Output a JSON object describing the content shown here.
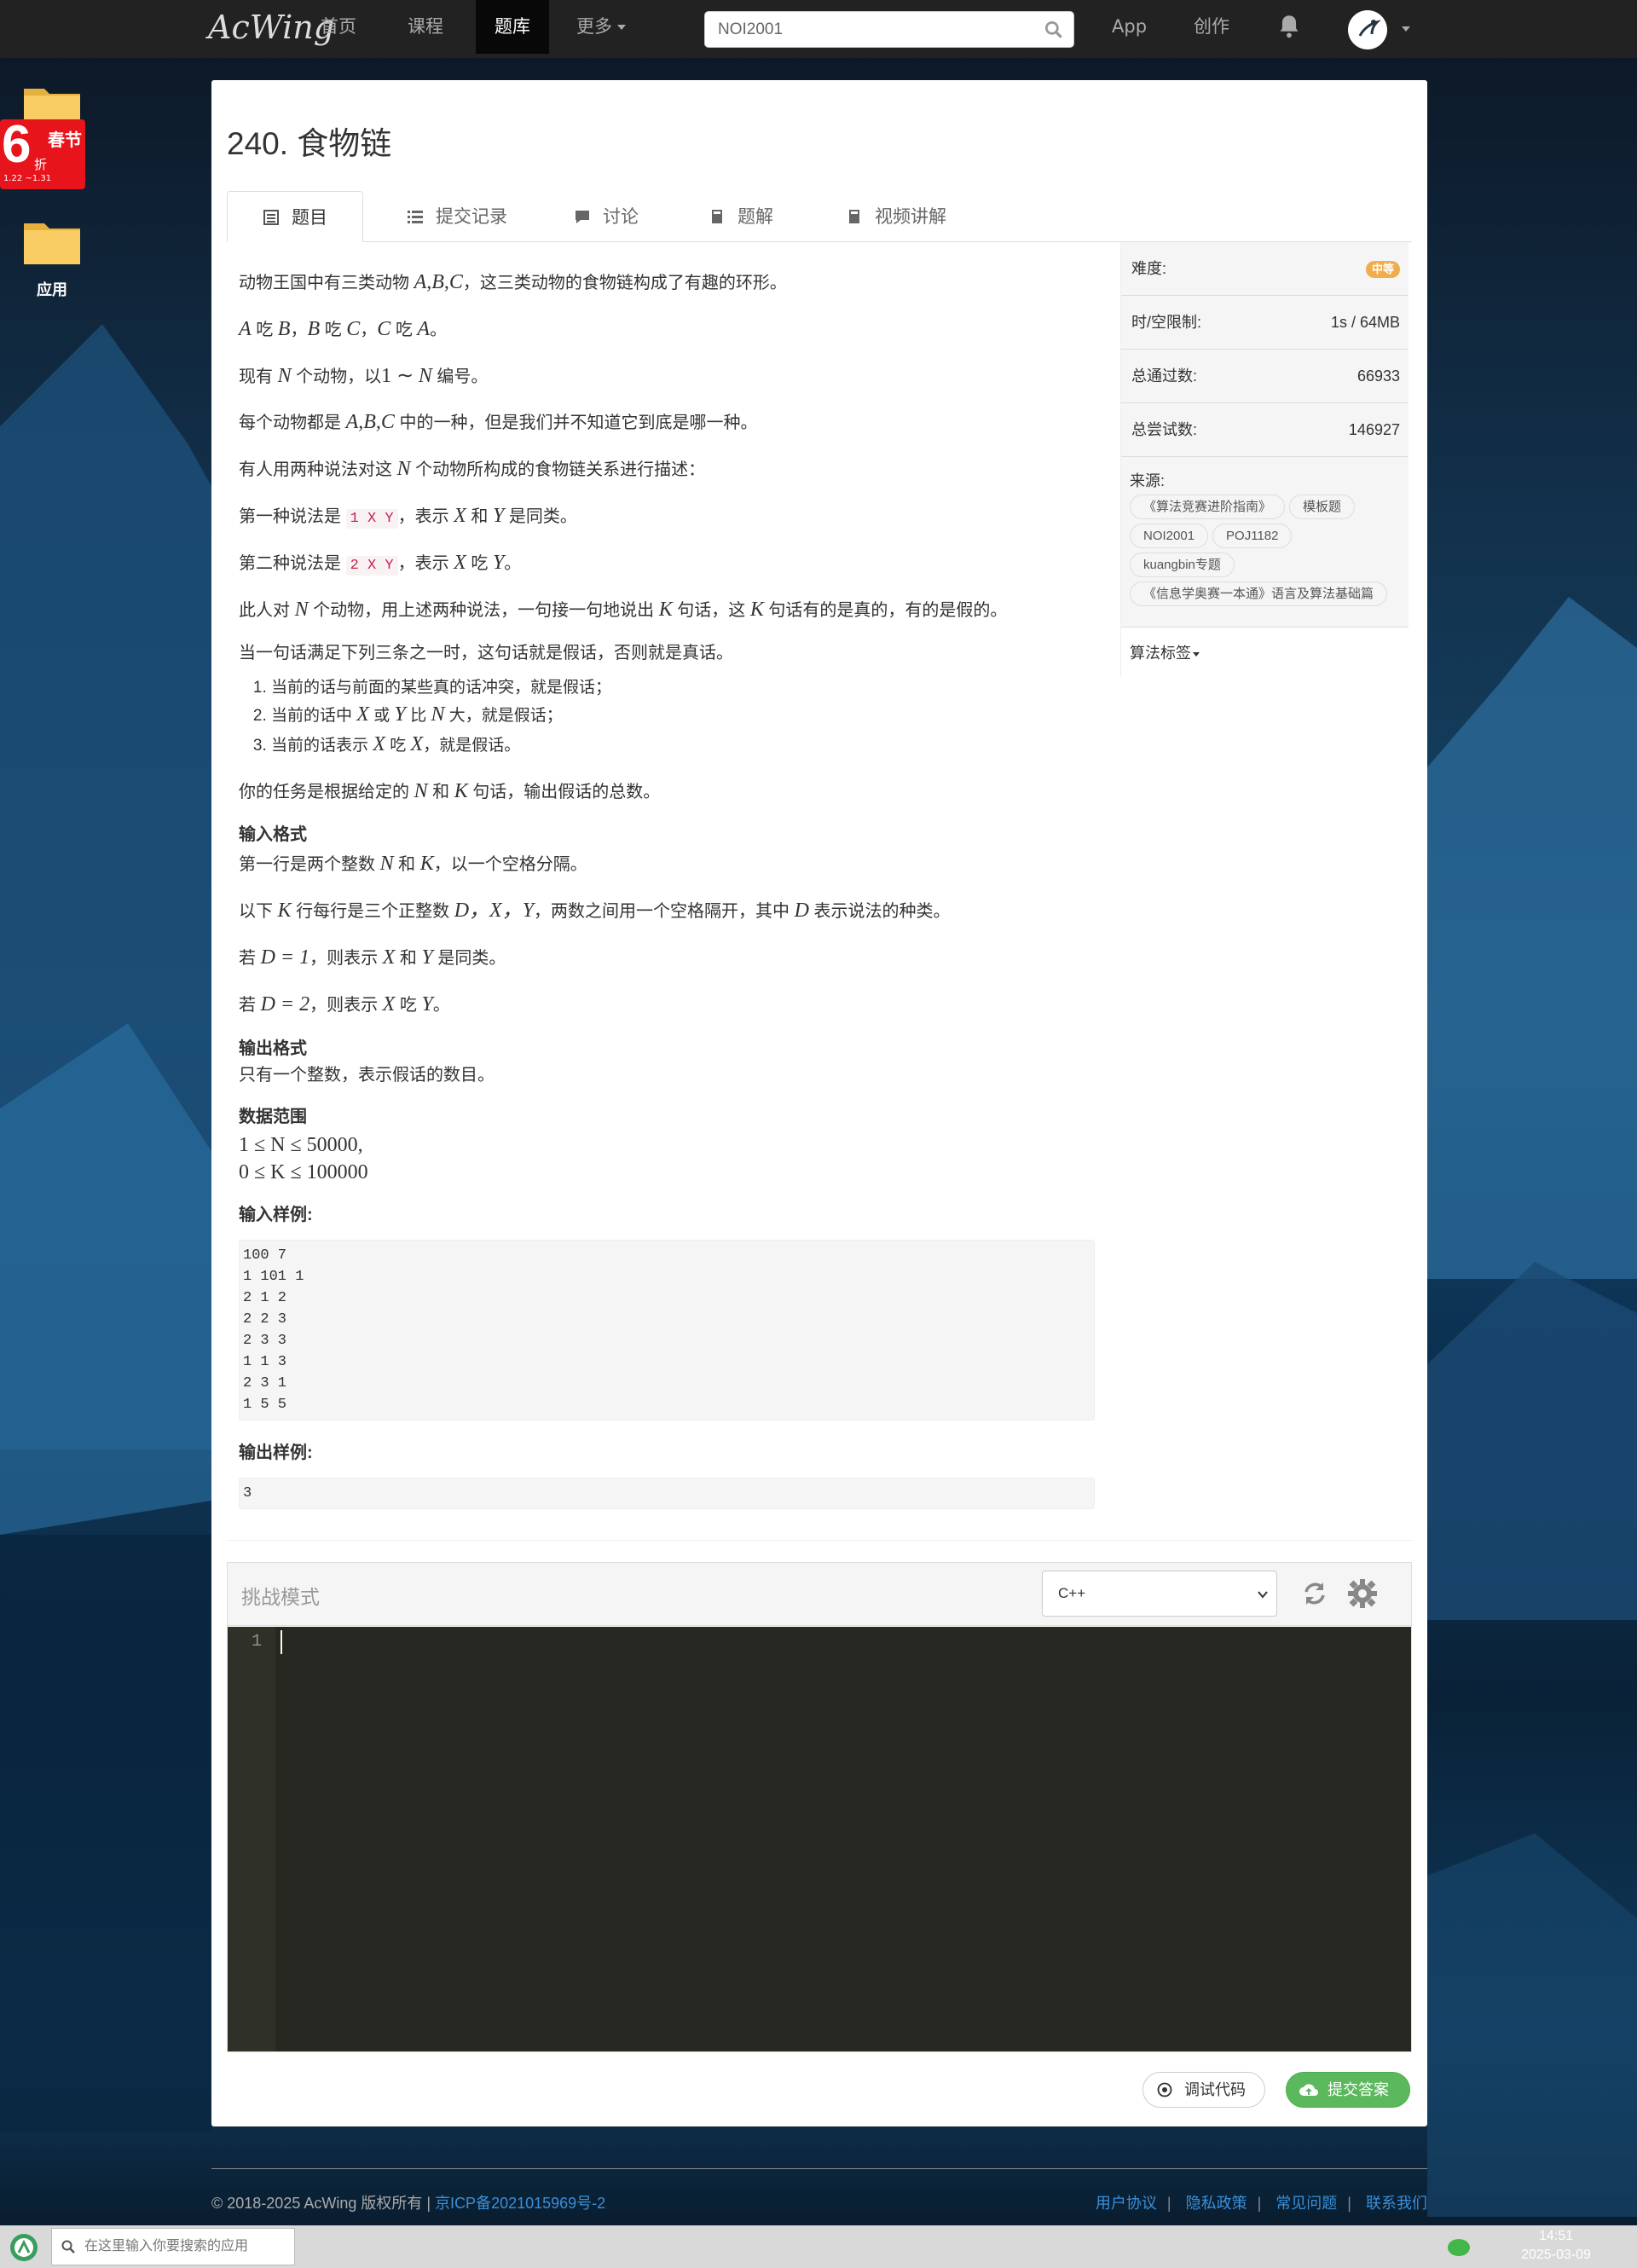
{
  "navbar": {
    "logo": "AcWing",
    "items": [
      {
        "label": "首页"
      },
      {
        "label": "课程"
      },
      {
        "label": "题库"
      },
      {
        "label": "更多"
      },
      {
        "label": "App"
      },
      {
        "label": "创作"
      }
    ],
    "search_value": "NOI2001"
  },
  "desktop": {
    "promo_big": "6",
    "promo_title": "春节",
    "promo_unit": "折",
    "promo_dates": "1.22 ~1.31",
    "app_label": "应用"
  },
  "problem": {
    "title": "240. 食物链",
    "tabs": [
      {
        "label": "题目"
      },
      {
        "label": "提交记录"
      },
      {
        "label": "讨论"
      },
      {
        "label": "题解"
      },
      {
        "label": "视频讲解"
      }
    ]
  },
  "statement": {
    "p1_a": "动物王国中有三类动物",
    "p1_math": "A,B,C",
    "p1_b": "，这三类动物的食物链构成了有趣的环形。",
    "p2": [
      "A",
      "吃",
      "B",
      "，",
      "B",
      "吃",
      "C",
      "，",
      "C",
      "吃",
      "A",
      "。"
    ],
    "p3_a": "现有",
    "p3_m1": "N",
    "p3_b": "个动物，以",
    "p3_m2": "1 ∼",
    "p3_m3": "N",
    "p3_c": "编号。",
    "p4_a": "每个动物都是",
    "p4_m": "A,B,C",
    "p4_b": "中的一种，但是我们并不知道它到底是哪一种。",
    "p5_a": "有人用两种说法对这",
    "p5_m": "N",
    "p5_b": "个动物所构成的食物链关系进行描述：",
    "p6_a": "第一种说法是",
    "p6_code": "1 X Y",
    "p6_b": "，表示",
    "p6_m1": "X",
    "p6_c": "和",
    "p6_m2": "Y",
    "p6_d": "是同类。",
    "p7_a": "第二种说法是",
    "p7_code": "2 X Y",
    "p7_b": "，表示",
    "p7_m1": "X",
    "p7_c": "吃",
    "p7_m2": "Y",
    "p7_d": "。",
    "p8_a": "此人对",
    "p8_m1": "N",
    "p8_b": "个动物，用上述两种说法，一句接一句地说出",
    "p8_m2": "K",
    "p8_c": "句话，这",
    "p8_m3": "K",
    "p8_d": "句话有的是真的，有的是假的。",
    "p9": "当一句话满足下列三条之一时，这句话就是假话，否则就是真话。",
    "li1": "当前的话与前面的某些真的话冲突，就是假话；",
    "li2_a": "当前的话中",
    "li2_m1": "X",
    "li2_b": "或",
    "li2_m2": "Y",
    "li2_c": "比",
    "li2_m3": "N",
    "li2_d": "大，就是假话；",
    "li3_a": "当前的话表示",
    "li3_m1": "X",
    "li3_b": "吃",
    "li3_m2": "X",
    "li3_c": "，就是假话。",
    "p10_a": "你的任务是根据给定的",
    "p10_m1": "N",
    "p10_b": "和",
    "p10_m2": "K",
    "p10_c": "句话，输出假话的总数。",
    "h_input": "输入格式",
    "in1_a": "第一行是两个整数",
    "in1_m1": "N",
    "in1_b": "和",
    "in1_m2": "K",
    "in1_c": "，以一个空格分隔。",
    "in2_a": "以下",
    "in2_m1": "K",
    "in2_b": "行每行是三个正整数",
    "in2_m2": "D，X，Y",
    "in2_c": "，两数之间用一个空格隔开，其中",
    "in2_m3": "D",
    "in2_d": "表示说法的种类。",
    "in3_a": "若",
    "in3_m": "D = 1",
    "in3_b": "，则表示",
    "in3_m1": "X",
    "in3_c": "和",
    "in3_m2": "Y",
    "in3_d": "是同类。",
    "in4_a": "若",
    "in4_m": "D = 2",
    "in4_b": "，则表示",
    "in4_m1": "X",
    "in4_c": "吃",
    "in4_m2": "Y",
    "in4_d": "。",
    "h_output": "输出格式",
    "out1": "只有一个整数，表示假话的数目。",
    "h_range": "数据范围",
    "range1": "1 ≤ N ≤ 50000,",
    "range2": "0 ≤ K ≤ 100000",
    "h_sample_in": "输入样例:",
    "sample_in": "100 7\n1 101 1\n2 1 2\n2 2 3\n2 3 3\n1 1 3\n2 3 1\n1 5 5",
    "h_sample_out": "输出样例:",
    "sample_out": "3"
  },
  "sidebar": {
    "difficulty_label": "难度:",
    "difficulty_value": "中等",
    "limit_label": "时/空限制:",
    "limit_value": "1s / 64MB",
    "passed_label": "总通过数:",
    "passed_value": "66933",
    "tried_label": "总尝试数:",
    "tried_value": "146927",
    "source_label": "来源:",
    "source_tags": [
      "《算法竞赛进阶指南》",
      "模板题",
      "NOI2001",
      "POJ1182",
      "kuangbin专题",
      "《信息学奥赛一本通》语言及算法基础篇"
    ],
    "algo_label": "算法标签"
  },
  "editor": {
    "mode_label": "挑战模式",
    "language": "C++",
    "line_number": "1",
    "debug_label": "调试代码",
    "submit_label": "提交答案"
  },
  "footer": {
    "copyright": "© 2018-2025 AcWing 版权所有  |",
    "icp": "京ICP备2021015969号-2",
    "links": [
      "用户协议",
      "隐私政策",
      "常见问题",
      "联系我们"
    ]
  },
  "taskbar": {
    "search_placeholder": "在这里输入你要搜索的应用",
    "time": "14:51",
    "date": "2025-03-09"
  },
  "colors": {
    "accent_green": "#5cb85c",
    "difficulty_badge": "#f0ad4e",
    "navbar_bg": "#222222",
    "editor_bg": "#272822",
    "link_blue": "#3a8fd8"
  },
  "icons": [
    "search-icon",
    "bell-icon",
    "folder-icon",
    "list-icon",
    "comment-icon",
    "book-icon",
    "refresh-icon",
    "gear-icon",
    "play-circle-icon",
    "cloud-upload-icon",
    "wechat-icon"
  ]
}
